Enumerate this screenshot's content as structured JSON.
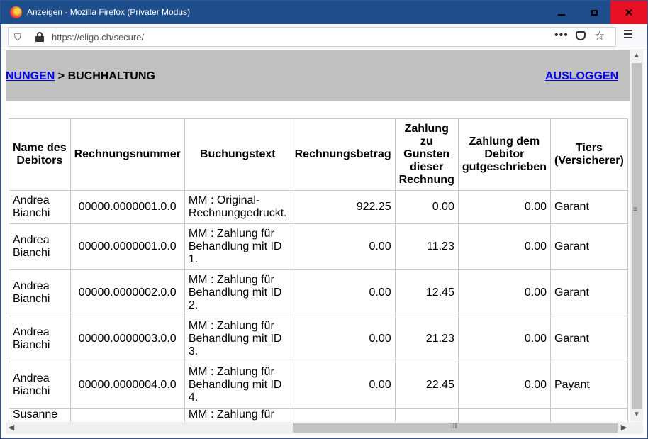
{
  "window": {
    "title": "Anzeigen - Mozilla Firefox (Privater Modus)",
    "min_glyph": "",
    "close_glyph": "✕"
  },
  "navbar": {
    "url": "https://eligo.ch/secure/",
    "more_glyph": "•••",
    "star_glyph": "☆",
    "shield_glyph": "⛉"
  },
  "page": {
    "breadcrumb_link": "NUNGEN",
    "breadcrumb_sep": " > ",
    "breadcrumb_current": "BUCHHALTUNG",
    "logout": "AUSLOGGEN"
  },
  "table": {
    "headers": [
      [
        "Name des",
        "Debitors"
      ],
      [
        "Rechnungsnummer"
      ],
      [
        "Buchungstext"
      ],
      [
        "Rechnungsbetrag"
      ],
      [
        "Zahlung",
        "zu",
        "Gunsten",
        "dieser",
        "Rechnung"
      ],
      [
        "Zahlung dem",
        "Debitor",
        "gutgeschrieben"
      ],
      [
        "Tiers",
        "(Versicherer)"
      ]
    ],
    "rows": [
      {
        "name": [
          "Andrea",
          "Bianchi"
        ],
        "invoice": "00000.0000001.0.0",
        "text": [
          "MM : Original-",
          "Rechnunggedruckt."
        ],
        "amount": "922.25",
        "payment": "0.00",
        "credited": "0.00",
        "tiers": "Garant"
      },
      {
        "name": [
          "Andrea",
          "Bianchi"
        ],
        "invoice": "00000.0000001.0.0",
        "text": [
          "MM : Zahlung für",
          "Behandlung mit ID",
          "1."
        ],
        "amount": "0.00",
        "payment": "11.23",
        "credited": "0.00",
        "tiers": "Garant"
      },
      {
        "name": [
          "Andrea",
          "Bianchi"
        ],
        "invoice": "00000.0000002.0.0",
        "text": [
          "MM : Zahlung für",
          "Behandlung mit ID",
          "2."
        ],
        "amount": "0.00",
        "payment": "12.45",
        "credited": "0.00",
        "tiers": "Garant"
      },
      {
        "name": [
          "Andrea",
          "Bianchi"
        ],
        "invoice": "00000.0000003.0.0",
        "text": [
          "MM : Zahlung für",
          "Behandlung mit ID",
          "3."
        ],
        "amount": "0.00",
        "payment": "21.23",
        "credited": "0.00",
        "tiers": "Garant"
      },
      {
        "name": [
          "Andrea",
          "Bianchi"
        ],
        "invoice": "00000.0000004.0.0",
        "text": [
          "MM : Zahlung für",
          "Behandlung mit ID",
          "4."
        ],
        "amount": "0.00",
        "payment": "22.45",
        "credited": "0.00",
        "tiers": "Payant"
      },
      {
        "name": [
          "Susanne",
          ""
        ],
        "invoice": "",
        "text": [
          "MM : Zahlung für",
          ""
        ],
        "amount": "",
        "payment": "",
        "credited": "",
        "tiers": ""
      }
    ]
  },
  "scroll": {
    "up": "▲",
    "down": "▼",
    "left": "◀",
    "right": "▶",
    "v_grip": "≡",
    "h_grip": "III"
  }
}
